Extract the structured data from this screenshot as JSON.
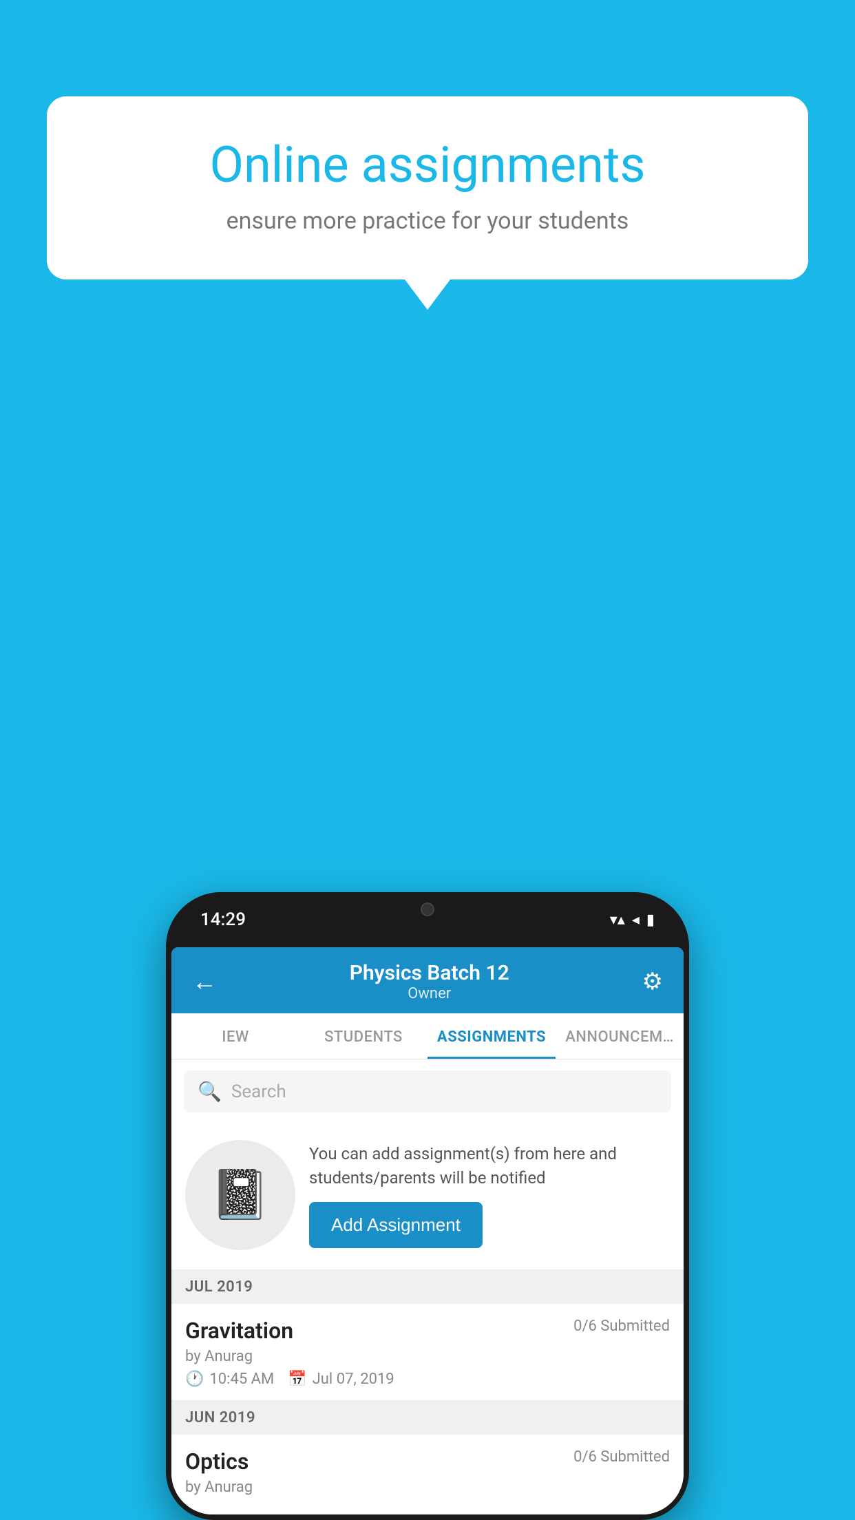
{
  "background": {
    "color": "#1ab8e8"
  },
  "speech_bubble": {
    "title": "Online assignments",
    "subtitle": "ensure more practice for your students"
  },
  "phone": {
    "status_bar": {
      "time": "14:29",
      "wifi": "▼▲",
      "signal": "◀",
      "battery": "▐"
    },
    "header": {
      "title": "Physics Batch 12",
      "subtitle": "Owner",
      "back_label": "←",
      "settings_label": "⚙"
    },
    "tabs": [
      {
        "label": "IEW",
        "active": false
      },
      {
        "label": "STUDENTS",
        "active": false
      },
      {
        "label": "ASSIGNMENTS",
        "active": true
      },
      {
        "label": "ANNOUNCEM…",
        "active": false
      }
    ],
    "search": {
      "placeholder": "Search"
    },
    "promo": {
      "text": "You can add assignment(s) from here and students/parents will be notified",
      "button_label": "Add Assignment"
    },
    "sections": [
      {
        "title": "JUL 2019",
        "assignments": [
          {
            "name": "Gravitation",
            "submitted": "0/6 Submitted",
            "by": "by Anurag",
            "time": "10:45 AM",
            "date": "Jul 07, 2019"
          }
        ]
      },
      {
        "title": "JUN 2019",
        "assignments": [
          {
            "name": "Optics",
            "submitted": "0/6 Submitted",
            "by": "by Anurag",
            "time": "",
            "date": ""
          }
        ]
      }
    ]
  }
}
